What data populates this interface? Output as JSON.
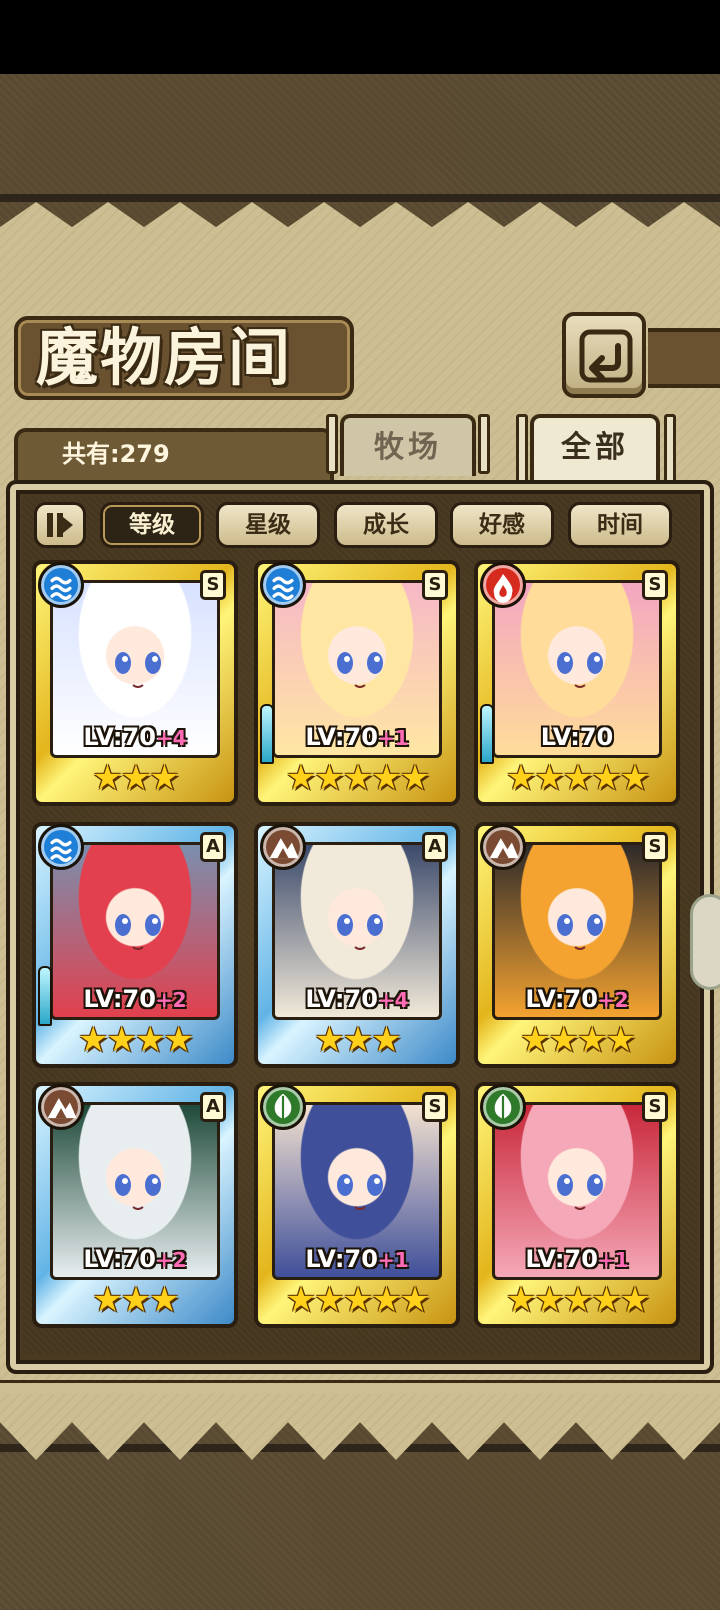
{
  "header": {
    "title": "魔物房间"
  },
  "summary": {
    "count_text": "共有:279"
  },
  "tabs": [
    {
      "label": "牧场",
      "active": false
    },
    {
      "label": "全部",
      "active": true
    }
  ],
  "sort": {
    "options": [
      "等级",
      "星级",
      "成长",
      "好感",
      "时间"
    ],
    "active": "等级"
  },
  "monsters": [
    {
      "element": "water",
      "element_color": "#1f7fd6",
      "rank": "S",
      "level": "LV:70",
      "bonus": "+4",
      "stars": 3,
      "star_text": "★★★",
      "frame": "gold",
      "portrait": [
        "#ffffff",
        "#d8e2ff"
      ],
      "weapon": false
    },
    {
      "element": "water",
      "element_color": "#1f7fd6",
      "rank": "S",
      "level": "LV:70",
      "bonus": "+1",
      "stars": 5,
      "star_text": "★★★★★",
      "frame": "gold",
      "portrait": [
        "#ffe7a3",
        "#f6b8c6"
      ],
      "weapon": true
    },
    {
      "element": "fire",
      "element_color": "#d62a1f",
      "rank": "S",
      "level": "LV:70",
      "bonus": "",
      "stars": 5,
      "star_text": "★★★★★",
      "frame": "gold",
      "portrait": [
        "#ffdc9a",
        "#f3a6c1"
      ],
      "weapon": true
    },
    {
      "element": "water",
      "element_color": "#1f7fd6",
      "rank": "A",
      "level": "LV:70",
      "bonus": "+2",
      "stars": 4,
      "star_text": "★★★★",
      "frame": "blue",
      "portrait": [
        "#e2404e",
        "#7a8fae"
      ],
      "weapon": true
    },
    {
      "element": "earth",
      "element_color": "#7a4b32",
      "rank": "A",
      "level": "LV:70",
      "bonus": "+4",
      "stars": 3,
      "star_text": "★★★",
      "frame": "blue",
      "portrait": [
        "#f1e9d9",
        "#3c4a6b"
      ],
      "weapon": false
    },
    {
      "element": "earth",
      "element_color": "#7a4b32",
      "rank": "S",
      "level": "LV:70",
      "bonus": "+2",
      "stars": 4,
      "star_text": "★★★★",
      "frame": "gold",
      "portrait": [
        "#f4a330",
        "#2e2a2a"
      ],
      "weapon": false
    },
    {
      "element": "earth",
      "element_color": "#7a4b32",
      "rank": "A",
      "level": "LV:70",
      "bonus": "+2",
      "stars": 3,
      "star_text": "★★★",
      "frame": "blue",
      "portrait": [
        "#e8eef0",
        "#1f4a3a"
      ],
      "weapon": false
    },
    {
      "element": "wood",
      "element_color": "#2f7a2a",
      "rank": "S",
      "level": "LV:70",
      "bonus": "+1",
      "stars": 5,
      "star_text": "★★★★★",
      "frame": "gold",
      "portrait": [
        "#3f4f9a",
        "#f3e1d0"
      ],
      "weapon": false
    },
    {
      "element": "wood",
      "element_color": "#2f7a2a",
      "rank": "S",
      "level": "LV:70",
      "bonus": "+1",
      "stars": 5,
      "star_text": "★★★★★",
      "frame": "gold",
      "portrait": [
        "#f5a8b8",
        "#c8283a"
      ],
      "weapon": false
    }
  ]
}
